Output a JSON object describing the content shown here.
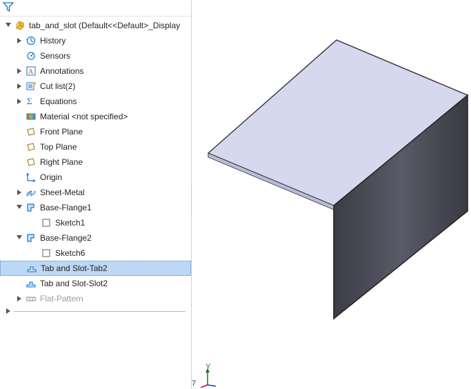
{
  "filter": {
    "tooltip": "Filter"
  },
  "root": {
    "label": "tab_and_slot (Default<<Default>_Display"
  },
  "tree": [
    {
      "indent": 1,
      "exp": "closed",
      "iconKey": "history",
      "label": "History",
      "interactable": true
    },
    {
      "indent": 1,
      "exp": "none",
      "iconKey": "sensors",
      "label": "Sensors",
      "interactable": true
    },
    {
      "indent": 1,
      "exp": "closed",
      "iconKey": "annotations",
      "label": "Annotations",
      "interactable": true
    },
    {
      "indent": 1,
      "exp": "closed",
      "iconKey": "cutlist",
      "label": "Cut list(2)",
      "interactable": true
    },
    {
      "indent": 1,
      "exp": "closed",
      "iconKey": "equations",
      "label": "Equations",
      "interactable": true
    },
    {
      "indent": 1,
      "exp": "none",
      "iconKey": "material",
      "label": "Material <not specified>",
      "interactable": true
    },
    {
      "indent": 1,
      "exp": "none",
      "iconKey": "plane",
      "label": "Front Plane",
      "interactable": true
    },
    {
      "indent": 1,
      "exp": "none",
      "iconKey": "plane",
      "label": "Top Plane",
      "interactable": true
    },
    {
      "indent": 1,
      "exp": "none",
      "iconKey": "plane",
      "label": "Right Plane",
      "interactable": true
    },
    {
      "indent": 1,
      "exp": "none",
      "iconKey": "origin",
      "label": "Origin",
      "interactable": true
    },
    {
      "indent": 1,
      "exp": "closed",
      "iconKey": "sheetmetal",
      "label": "Sheet-Metal",
      "interactable": true
    },
    {
      "indent": 1,
      "exp": "open",
      "iconKey": "flange",
      "label": "Base-Flange1",
      "interactable": true
    },
    {
      "indent": 2,
      "exp": "none",
      "iconKey": "sketch",
      "label": "Sketch1",
      "interactable": true
    },
    {
      "indent": 1,
      "exp": "open",
      "iconKey": "flange",
      "label": "Base-Flange2",
      "interactable": true
    },
    {
      "indent": 2,
      "exp": "none",
      "iconKey": "sketch",
      "label": "Sketch6",
      "interactable": true
    },
    {
      "indent": 1,
      "exp": "none",
      "iconKey": "tabslot",
      "label": "Tab and Slot-Tab2",
      "interactable": true,
      "selected": true
    },
    {
      "indent": 1,
      "exp": "none",
      "iconKey": "tabslot",
      "label": "Tab and Slot-Slot2",
      "interactable": true
    },
    {
      "indent": 1,
      "exp": "closed",
      "iconKey": "flatpattern",
      "label": "Flat-Pattern",
      "interactable": true,
      "dim": true
    }
  ],
  "triad": {
    "y_label": "Y",
    "seven": "7"
  },
  "colors": {
    "model_top": "#d6d9ee",
    "model_side": "#48484f"
  }
}
